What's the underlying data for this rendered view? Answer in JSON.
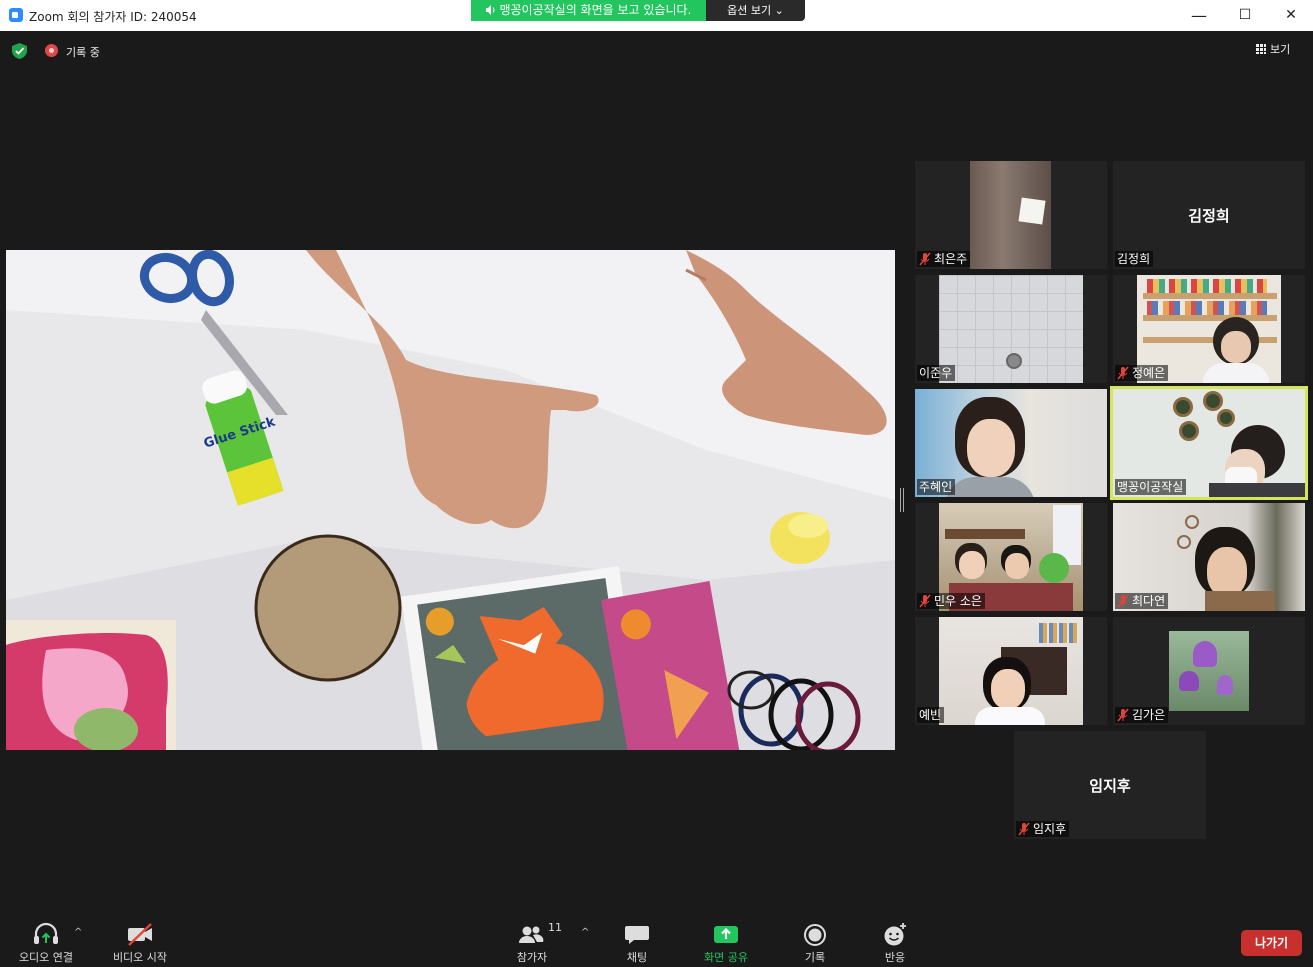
{
  "window": {
    "title": "Zoom 회의 참가자 ID: 240054",
    "minimize": "—",
    "maximize": "☐",
    "close": "✕"
  },
  "share_banner": {
    "text": "맹꽁이공작실의 화면을 보고 있습니다.",
    "options": "옵션 보기 ⌄"
  },
  "status": {
    "recording": "기록 중",
    "view": "보기"
  },
  "shared_screen": {
    "glue_text": "Glue Stick"
  },
  "participants": [
    {
      "name": "최은주",
      "muted": true,
      "video": true
    },
    {
      "name": "김정희",
      "big": "김정희",
      "muted": false,
      "video": false
    },
    {
      "name": "이준우",
      "muted": false,
      "video": true
    },
    {
      "name": "정예은",
      "muted": true,
      "video": true
    },
    {
      "name": "주혜인",
      "muted": false,
      "video": true
    },
    {
      "name": "맹꽁이공작실",
      "muted": false,
      "video": true,
      "active": true
    },
    {
      "name": "민우 소은",
      "muted": true,
      "video": true
    },
    {
      "name": "최다연",
      "muted": true,
      "video": true
    },
    {
      "name": "예빈",
      "muted": false,
      "video": true
    },
    {
      "name": "김가은",
      "muted": true,
      "video": true
    },
    {
      "name": "임지후",
      "big": "임지후",
      "muted": true,
      "video": false
    }
  ],
  "toolbar": {
    "audio": "오디오 연결",
    "video": "비디오 시작",
    "participants": "참가자",
    "participants_count": "11",
    "chat": "채팅",
    "share": "화면 공유",
    "record": "기록",
    "reactions": "반응",
    "leave": "나가기"
  },
  "colors": {
    "banner_green": "#22c55e",
    "leave_red": "#c8302e",
    "active_speaker": "#d6e65a",
    "mute_red": "#e0453a"
  },
  "icons": [
    "zoom-app-icon",
    "shield-icon",
    "record-icon",
    "grid-view-icon",
    "muted-mic-icon",
    "headphones-icon",
    "video-off-icon",
    "participants-icon",
    "chat-icon",
    "share-screen-icon",
    "record-button-icon",
    "reaction-icon"
  ]
}
